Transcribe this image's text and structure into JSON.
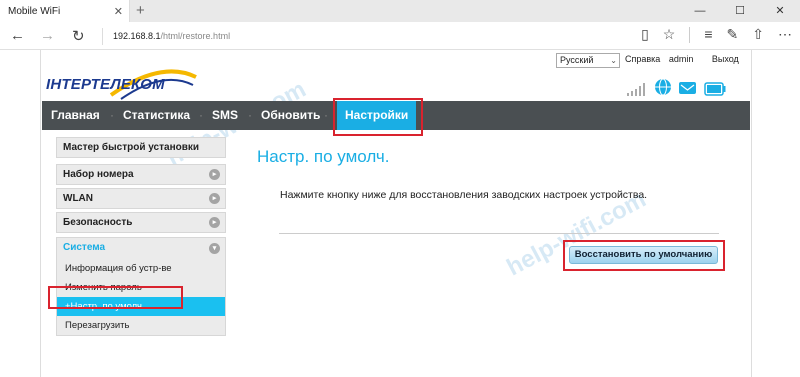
{
  "browser": {
    "tab_title": "Mobile WiFi",
    "tab_close": "✕",
    "new_tab": "+",
    "url_host": "192.168.8.1",
    "url_path": "/html/restore.html",
    "win_minimize": "—",
    "win_maximize": "☐",
    "win_close": "✕"
  },
  "header": {
    "logo_text": "ІНТЕРТЕЛЕКОМ",
    "language": "Русский",
    "help": "Справка",
    "user": "admin",
    "logout": "Выход"
  },
  "menu": {
    "items": [
      "Главная",
      "Статистика",
      "SMS",
      "Обновить",
      "Настройки"
    ],
    "separator": "·",
    "active": "Настройки"
  },
  "sidebar": {
    "quick_setup": "Мастер быстрой установки",
    "dial": "Набор номера",
    "wlan": "WLAN",
    "security": "Безопасность",
    "system": "Система",
    "system_items": [
      "Информация об устр-ве",
      "Изменить пароль",
      "+Настр. по умолч.",
      "Перезагрузить"
    ],
    "expand_glyph": "▸",
    "collapse_glyph": "▾"
  },
  "main": {
    "title": "Настр. по умолч.",
    "description": "Нажмите кнопку ниже для восстановления заводских настроек устройства.",
    "restore_button": "Восстановить по умолчанию"
  },
  "watermark": "help-wifi.com",
  "colors": {
    "accent": "#1aaee4",
    "menubar": "#4a4f52",
    "highlight": "#d9232e"
  }
}
